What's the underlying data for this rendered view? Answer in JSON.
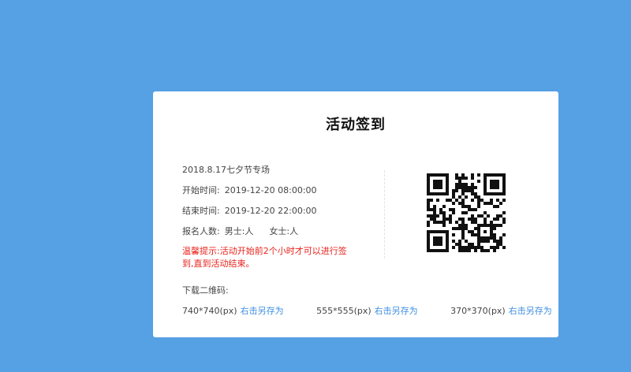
{
  "title": "活动签到",
  "event": {
    "name": "2018.8.17七夕节专场",
    "start_label": "开始时间:",
    "start_value": "2019-12-20 08:00:00",
    "end_label": "结束时间:",
    "end_value": "2019-12-20 22:00:00",
    "count_label": "报名人数:",
    "male_label": "男士:人",
    "female_label": "女士:人",
    "notice": "温馨提示:活动开始前2个小时才可以进行签到,直到活动结束。"
  },
  "qr_icon": "qr-code-icon",
  "download": {
    "label": "下载二维码:",
    "sizes": [
      {
        "size": "740*740(px)",
        "link": "右击另存为"
      },
      {
        "size": "555*555(px)",
        "link": "右击另存为"
      },
      {
        "size": "370*370(px)",
        "link": "右击另存为"
      }
    ]
  },
  "colors": {
    "background": "#56a0e4",
    "card": "#ffffff",
    "warning": "#e8231c",
    "link": "#3d8ee0"
  }
}
